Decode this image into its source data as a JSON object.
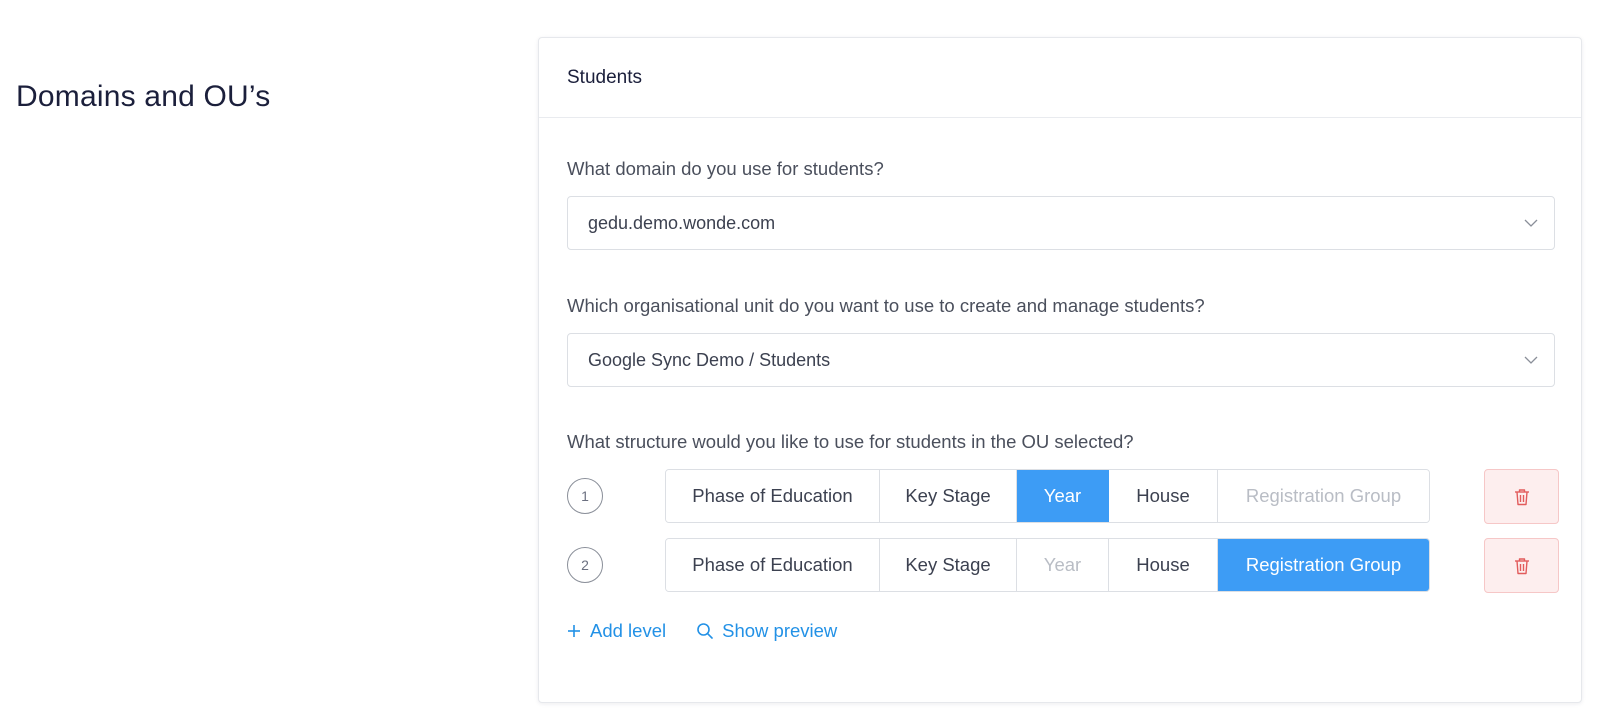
{
  "page": {
    "section_title": "Domains and OU’s"
  },
  "card": {
    "title": "Students",
    "domain": {
      "label": "What domain do you use for students?",
      "value": "gedu.demo.wonde.com"
    },
    "ou": {
      "label": "Which organisational unit do you want to use to create and manage students?",
      "value": "Google Sync Demo / Students"
    },
    "structure": {
      "label": "What structure would you like to use for students in the OU selected?",
      "levels": [
        {
          "number": "1",
          "options": [
            {
              "label": "Phase of Education",
              "state": "normal"
            },
            {
              "label": "Key Stage",
              "state": "normal"
            },
            {
              "label": "Year",
              "state": "active"
            },
            {
              "label": "House",
              "state": "normal"
            },
            {
              "label": "Registration Group",
              "state": "disabled"
            }
          ]
        },
        {
          "number": "2",
          "options": [
            {
              "label": "Phase of Education",
              "state": "normal"
            },
            {
              "label": "Key Stage",
              "state": "normal"
            },
            {
              "label": "Year",
              "state": "disabled"
            },
            {
              "label": "House",
              "state": "normal"
            },
            {
              "label": "Registration Group",
              "state": "active"
            }
          ]
        }
      ]
    },
    "actions": {
      "add_level": "Add level",
      "show_preview": "Show preview"
    }
  },
  "icons": {
    "chevron": "chevron-down-icon",
    "delete": "trash-icon",
    "add": "plus-icon",
    "preview": "search-icon"
  },
  "colors": {
    "accent": "#3d9cf5",
    "link": "#2291e6",
    "danger": "#e25b5b",
    "danger_bg": "#fdeeee"
  }
}
